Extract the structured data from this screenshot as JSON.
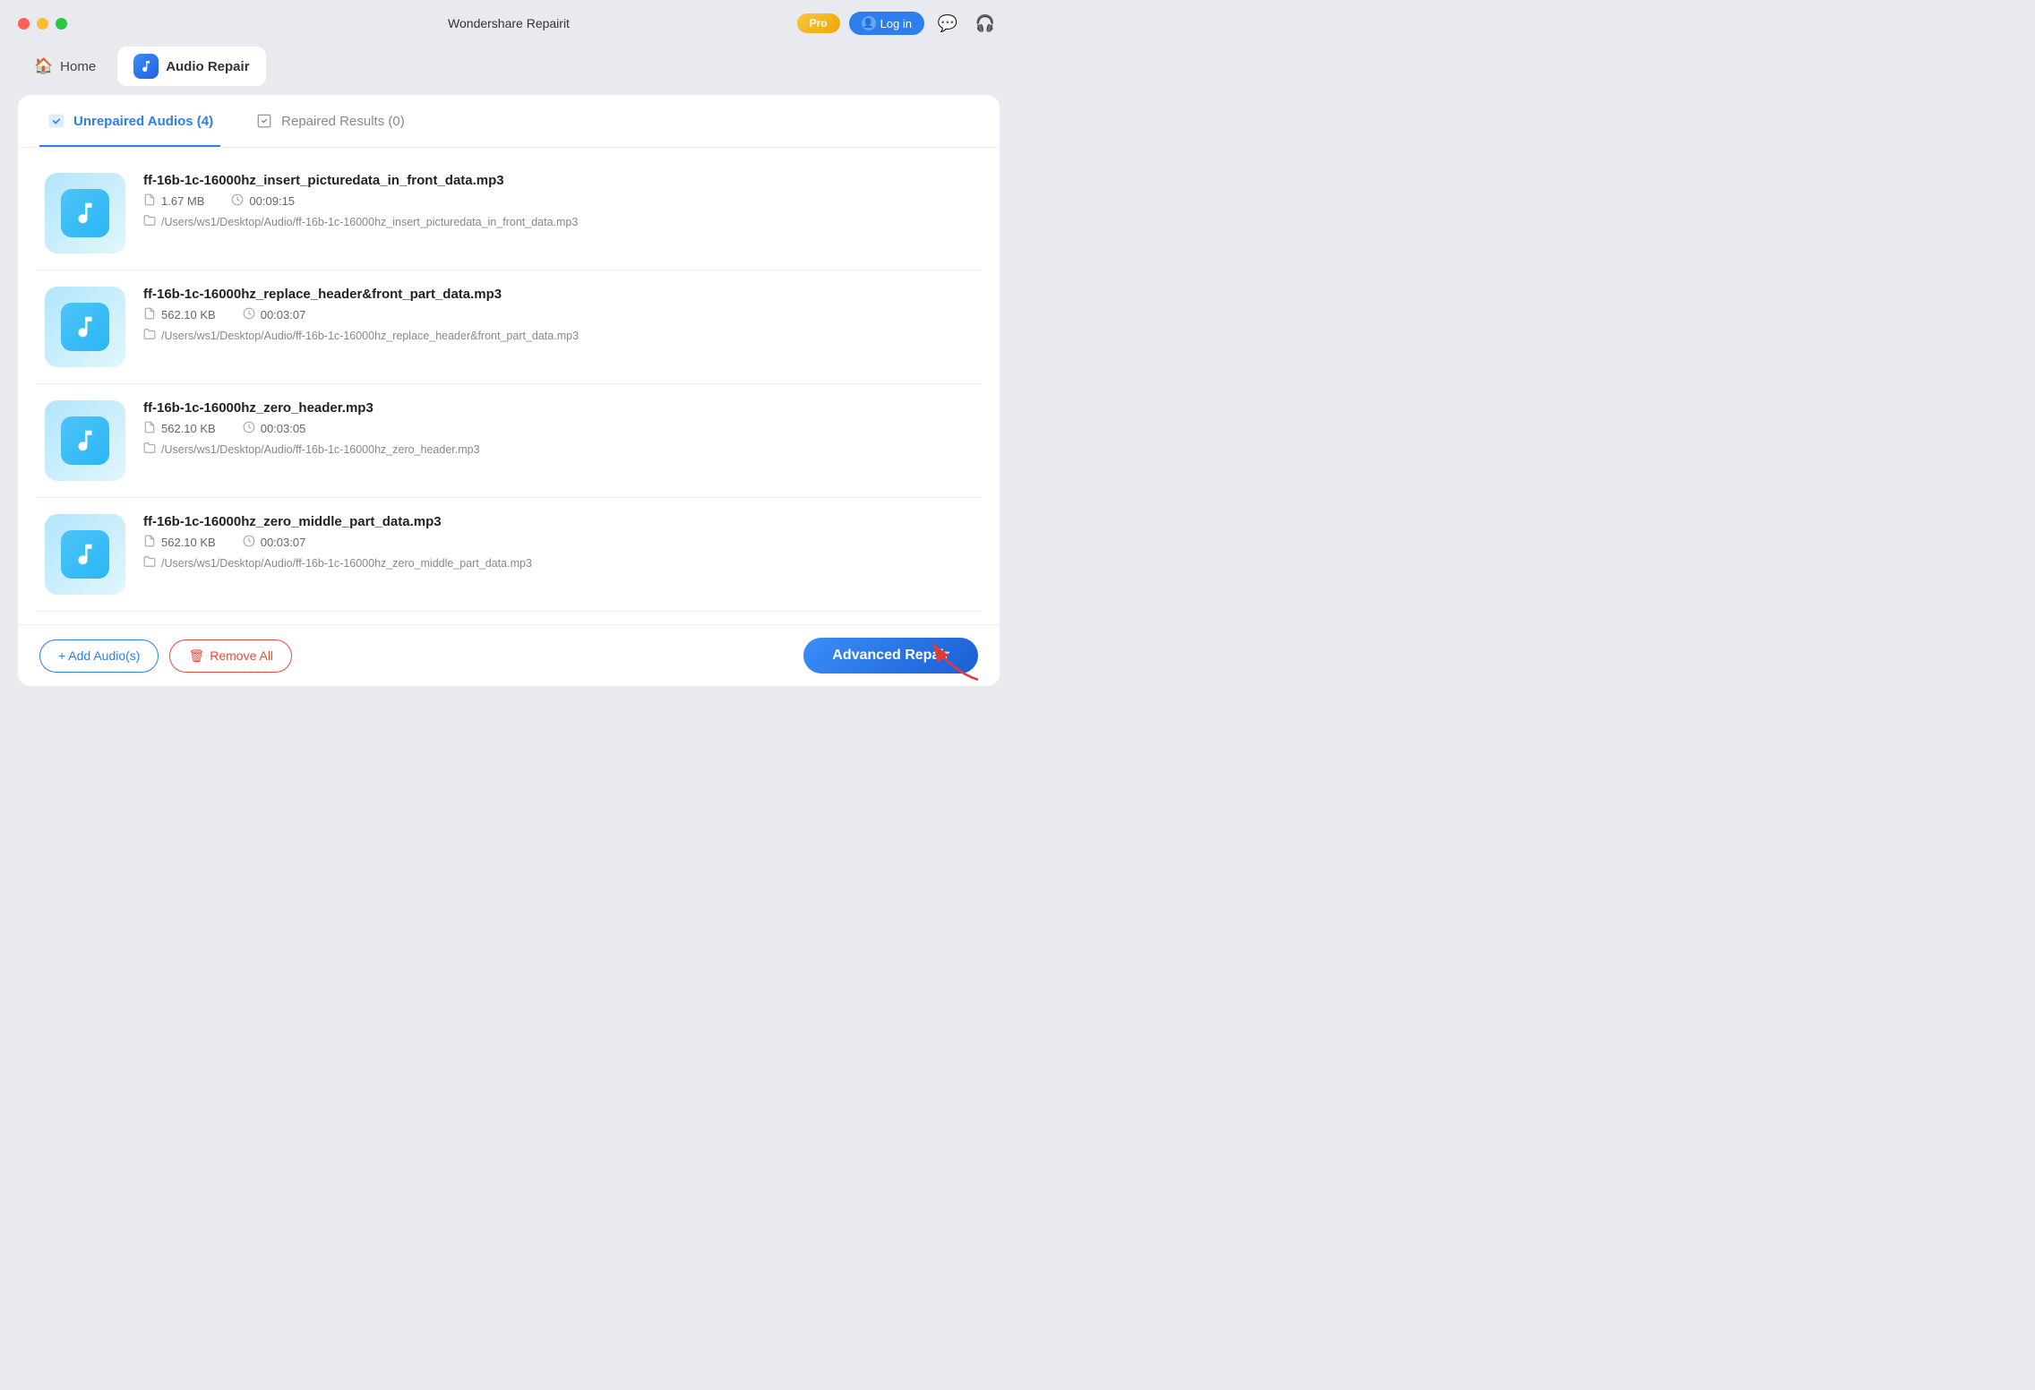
{
  "titlebar": {
    "title": "Wondershare Repairit",
    "pro_label": "Pro",
    "login_label": "Log in"
  },
  "navbar": {
    "home_label": "Home",
    "audio_label": "Audio Repair"
  },
  "tabs": {
    "unrepaired_label": "Unrepaired Audios (4)",
    "repaired_label": "Repaired Results (0)"
  },
  "files": [
    {
      "name": "ff-16b-1c-16000hz_insert_picturedata_in_front_data.mp3",
      "size": "1.67 MB",
      "duration": "00:09:15",
      "path": "/Users/ws1/Desktop/Audio/ff-16b-1c-16000hz_insert_picturedata_in_front_data.mp3"
    },
    {
      "name": "ff-16b-1c-16000hz_replace_header&front_part_data.mp3",
      "size": "562.10 KB",
      "duration": "00:03:07",
      "path": "/Users/ws1/Desktop/Audio/ff-16b-1c-16000hz_replace_header&front_part_data.mp3"
    },
    {
      "name": "ff-16b-1c-16000hz_zero_header.mp3",
      "size": "562.10 KB",
      "duration": "00:03:05",
      "path": "/Users/ws1/Desktop/Audio/ff-16b-1c-16000hz_zero_header.mp3"
    },
    {
      "name": "ff-16b-1c-16000hz_zero_middle_part_data.mp3",
      "size": "562.10 KB",
      "duration": "00:03:07",
      "path": "/Users/ws1/Desktop/Audio/ff-16b-1c-16000hz_zero_middle_part_data.mp3"
    }
  ],
  "buttons": {
    "add_label": "+ Add Audio(s)",
    "remove_label": "Remove All",
    "advanced_label": "Advanced Repair"
  }
}
